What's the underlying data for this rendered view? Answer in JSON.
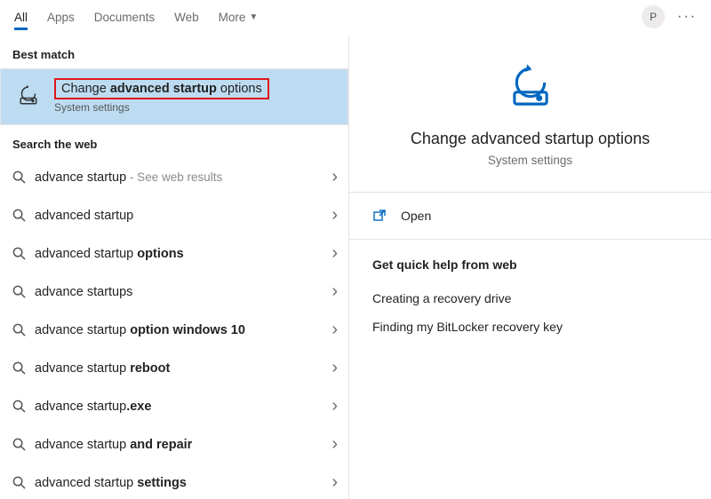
{
  "header": {
    "tabs": [
      "All",
      "Apps",
      "Documents",
      "Web",
      "More"
    ],
    "active_tab_index": 0,
    "avatar_letter": "P"
  },
  "left": {
    "best_match_label": "Best match",
    "best_match": {
      "title_pre": "Change ",
      "title_bold": "advanced startup",
      "title_post": " options",
      "subtitle": "System settings"
    },
    "search_web_label": "Search the web",
    "web_results": [
      {
        "pre": "advance startup",
        "bold": "",
        "post": "",
        "hint": " - See web results"
      },
      {
        "pre": "advanced startup",
        "bold": "",
        "post": "",
        "hint": ""
      },
      {
        "pre": "advanced startup ",
        "bold": "options",
        "post": "",
        "hint": ""
      },
      {
        "pre": "advance startups",
        "bold": "",
        "post": "",
        "hint": ""
      },
      {
        "pre": "advance startup ",
        "bold": "option windows 10",
        "post": "",
        "hint": ""
      },
      {
        "pre": "advance startup ",
        "bold": "reboot",
        "post": "",
        "hint": ""
      },
      {
        "pre": "advance startup",
        "bold": ".exe",
        "post": "",
        "hint": ""
      },
      {
        "pre": "advance startup ",
        "bold": "and repair",
        "post": "",
        "hint": ""
      },
      {
        "pre": "advanced startup ",
        "bold": "settings",
        "post": "",
        "hint": ""
      }
    ]
  },
  "right": {
    "title": "Change advanced startup options",
    "subtitle": "System settings",
    "open_label": "Open",
    "quick_help_title": "Get quick help from web",
    "quick_help_links": [
      "Creating a recovery drive",
      "Finding my BitLocker recovery key"
    ]
  },
  "colors": {
    "accent": "#0067c0"
  }
}
